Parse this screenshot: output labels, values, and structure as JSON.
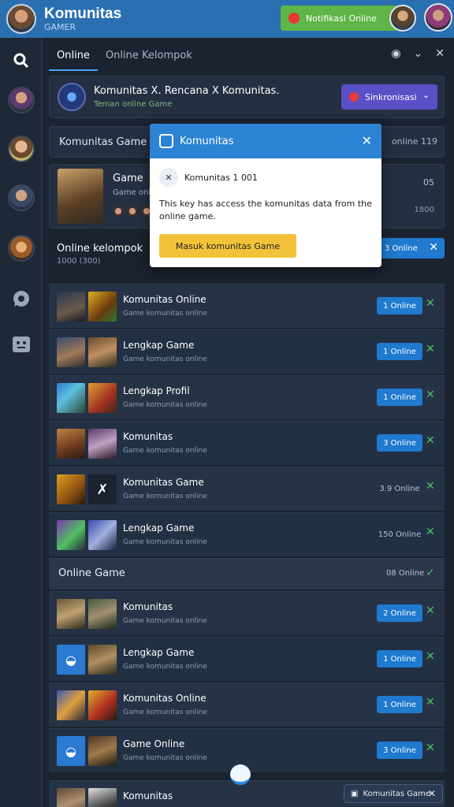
{
  "topbar": {
    "title": "Komunitas",
    "subtitle": "GAMER",
    "notification_label": "Notifikasi Online"
  },
  "tabs": {
    "online": "Online",
    "second": "Online  Kelompok"
  },
  "header": {
    "title": "Komunitas X. Rencana X  Komunitas.",
    "subtitle": "Teman online  Game",
    "button_label": "Sinkronisasi"
  },
  "section": {
    "label": "Komunitas  Game",
    "right": "online  119"
  },
  "game": {
    "title": "Game",
    "subtitle": "Game online",
    "right_top": "05",
    "right_bottom": "1800"
  },
  "online_bar": {
    "label": "Online  kelompok",
    "sub": "1000 (300)",
    "pill": "3 Online"
  },
  "popup": {
    "title": "Komunitas",
    "row_text": "Komunitas 1 001",
    "body": "This key has access the komunitas data from the online game.",
    "button": "Masuk komunitas  Game"
  },
  "list": [
    {
      "title": "Komunitas Online",
      "sub": "Game komunitas online",
      "count": "1 Online",
      "plain": false
    },
    {
      "title": "Lengkap  Game",
      "sub": "Game komunitas online",
      "count": "1 Online",
      "plain": false
    },
    {
      "title": "Lengkap  Profil",
      "sub": "Game komunitas online",
      "count": "1 Online",
      "plain": false
    },
    {
      "title": "Komunitas",
      "sub": "Game komunitas online",
      "count": "3 Online",
      "plain": false
    },
    {
      "title": "Komunitas Game",
      "sub": "Game komunitas online",
      "count": "3.9 Online",
      "plain": true
    },
    {
      "title": "Lengkap Game",
      "sub": "Game komunitas online",
      "count": "150 Online",
      "plain": true
    }
  ],
  "group": {
    "label": "Online  Game",
    "right": "08 Online"
  },
  "list2": [
    {
      "title": "Komunitas",
      "sub": "Game komunitas online",
      "count": "2 Online"
    },
    {
      "title": "Lengkap Game",
      "sub": "Game komunitas online",
      "count": "1 Online"
    },
    {
      "title": "Komunitas Online",
      "sub": "Game komunitas online",
      "count": "1 Online"
    },
    {
      "title": "Game Online",
      "sub": "Game komunitas online",
      "count": "3 Online"
    },
    {
      "title": "Komunitas",
      "sub": "",
      "count": ""
    }
  ],
  "toast": {
    "label": "Komunitas Game"
  },
  "icons": {
    "search": "search-icon",
    "chat": "chat-icon",
    "profile": "profile-icon"
  },
  "colors": {
    "topbar": "#2a6fb0",
    "accent_blue": "#1f7ad0",
    "purple": "#5a4fc6",
    "green": "#5fb547",
    "yellow": "#f2c33a"
  }
}
